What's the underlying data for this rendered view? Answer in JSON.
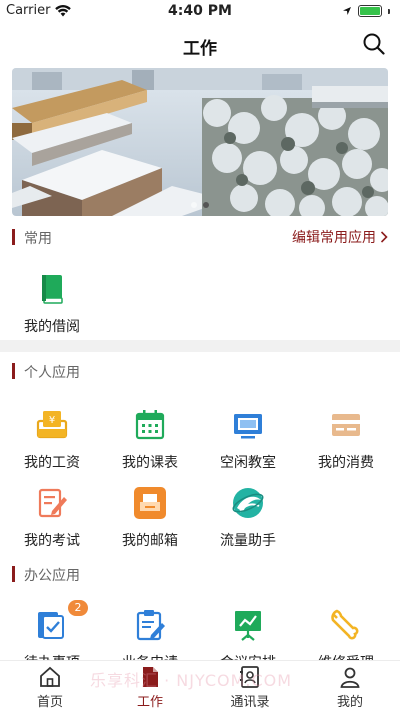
{
  "status_bar": {
    "carrier": "Carrier",
    "time": "4:40 PM",
    "battery_level": 1.0
  },
  "nav": {
    "title": "工作",
    "search_icon": "search-icon"
  },
  "banner": {
    "image": "snowy-campus-photo",
    "dots": 2,
    "active_dot": 1
  },
  "colors": {
    "accent": "#8b1c1c",
    "section_bar": "#8b1c1c",
    "badge": "#f08a3a",
    "battery": "#36c24a"
  },
  "common": {
    "title": "常用",
    "edit_label": "编辑常用应用",
    "items": [
      {
        "label": "我的借阅",
        "icon": "book-icon"
      }
    ]
  },
  "personal": {
    "title": "个人应用",
    "items": [
      {
        "label": "我的工资",
        "icon": "salary-icon"
      },
      {
        "label": "我的课表",
        "icon": "calendar-icon"
      },
      {
        "label": "空闲教室",
        "icon": "monitor-icon"
      },
      {
        "label": "我的消费",
        "icon": "card-icon"
      },
      {
        "label": "我的考试",
        "icon": "exam-icon"
      },
      {
        "label": "我的邮箱",
        "icon": "mailbox-icon"
      },
      {
        "label": "流量助手",
        "icon": "globe-icon"
      }
    ]
  },
  "office": {
    "title": "办公应用",
    "items": [
      {
        "label": "待办事项",
        "icon": "todo-icon",
        "badge": "2"
      },
      {
        "label": "业务申请",
        "icon": "clipboard-icon"
      },
      {
        "label": "会议安排",
        "icon": "presentation-icon"
      },
      {
        "label": "维修受理",
        "icon": "wrench-icon"
      }
    ]
  },
  "tabs": [
    {
      "label": "首页",
      "icon": "home-icon",
      "active": false
    },
    {
      "label": "工作",
      "icon": "document-icon",
      "active": true
    },
    {
      "label": "通讯录",
      "icon": "contacts-icon",
      "active": false
    },
    {
      "label": "我的",
      "icon": "user-icon",
      "active": false
    }
  ],
  "watermark": "乐享科汇 · NJYCOM.COM"
}
